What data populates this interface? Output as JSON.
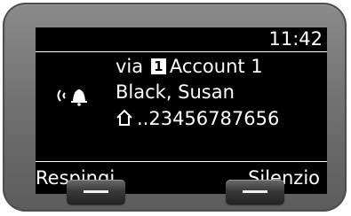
{
  "status": {
    "time": "11:42"
  },
  "call": {
    "via_label": "via",
    "account_number": "1",
    "account_name": "Account 1",
    "caller_name": "Black, Susan",
    "caller_number": "..23456787656",
    "ringer_icon": "ringing-bell-icon",
    "number_type_icon": "home-icon"
  },
  "softkeys": {
    "left_label": "Respingi",
    "right_label": "Silenzio"
  }
}
